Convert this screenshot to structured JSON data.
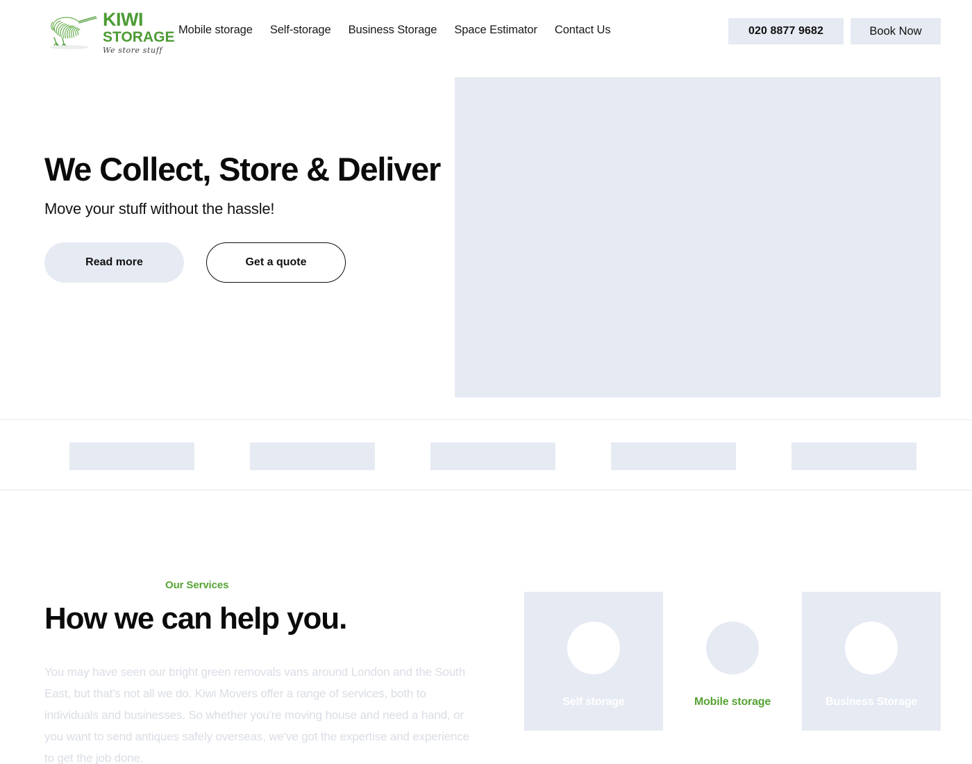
{
  "header": {
    "logo": {
      "icon": "kiwi-bird-logo",
      "brand_line1": "KIWI",
      "brand_line2": "STORAGE",
      "tagline": "We store stuff",
      "brand_color": "#4d9b35"
    },
    "nav": [
      {
        "label": "Mobile storage"
      },
      {
        "label": "Self-storage"
      },
      {
        "label": "Business Storage"
      },
      {
        "label": "Space Estimator"
      },
      {
        "label": "Contact Us"
      }
    ],
    "phone_label": "020 8877 9682",
    "book_label": "Book Now"
  },
  "hero": {
    "title": "We Collect, Store & Deliver",
    "subtitle": "Move your stuff without the hassle!",
    "primary_button": "Read more",
    "secondary_button": "Get a quote",
    "image_placeholder": "hero-image-placeholder"
  },
  "logo_strip": {
    "items": [
      {
        "name": "partner-logo-placeholder-1"
      },
      {
        "name": "partner-logo-placeholder-2"
      },
      {
        "name": "partner-logo-placeholder-3"
      },
      {
        "name": "partner-logo-placeholder-4"
      },
      {
        "name": "partner-logo-placeholder-5"
      }
    ]
  },
  "services": {
    "eyebrow": "Our Services",
    "eyebrow_color": "#57a336",
    "title": "How we can help you.",
    "paragraph": "You may have seen our bright green removals vans around London and the South East, but that's not all we do. Kiwi Movers offer a range of services, both to individuals and businesses. So whether you're moving house and need a hand, or you want to send antiques safely overseas, we've got the expertise and experience to get the job done.",
    "cards": [
      {
        "label": "Self storage",
        "style": "filled"
      },
      {
        "label": "Mobile storage",
        "style": "plain"
      },
      {
        "label": "Business Storage",
        "style": "filled"
      }
    ]
  },
  "colors": {
    "placeholder": "#e6eaf2",
    "brand_green": "#57a336",
    "divider": "#e4eaf3",
    "muted_text": "#d9dde4"
  }
}
